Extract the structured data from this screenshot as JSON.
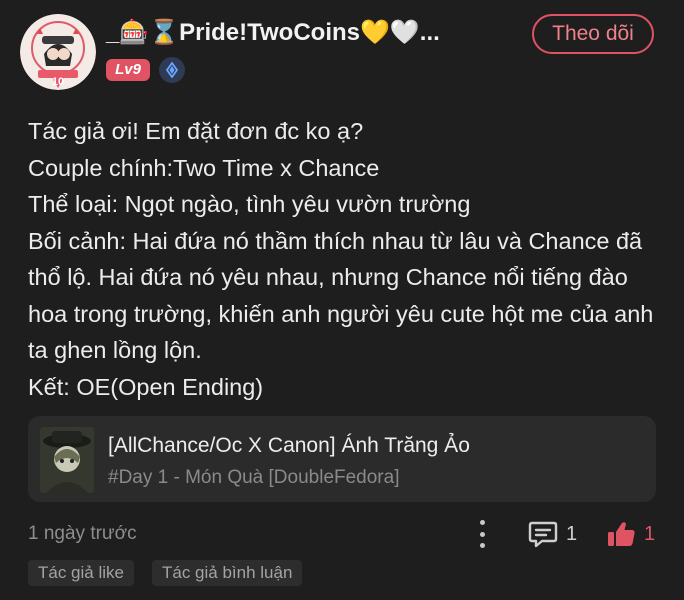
{
  "post": {
    "author": {
      "name": "_🎰⌛Pride!TwoCoins💛🤍...",
      "level": "Lv9",
      "avatar_badge": "10"
    },
    "follow_label": "Theo dõi",
    "body_lines": [
      "Tác giả ơi! Em đặt đơn đc ko ạ?",
      "Couple chính:Two Time x Chance",
      "Thể loại: Ngọt ngào, tình yêu vườn trường",
      "Bối cảnh: Hai đứa nó thầm thích nhau từ lâu và Chance đã thổ lộ. Hai đứa nó yêu nhau, nhưng Chance nổi tiếng đào hoa trong trường, khiến anh người yêu cute hột me của anh ta ghen lồng lộn.",
      "Kết: OE(Open Ending)"
    ],
    "story": {
      "title": "[AllChance/Oc X Canon] Ánh Trăng Ảo",
      "chapter": "#Day 1 - Món Quà [DoubleFedora]"
    },
    "time_ago": "1 ngày trước",
    "comment_count": "1",
    "like_count": "1",
    "tags": [
      "Tác giả like",
      "Tác giả bình luận"
    ]
  },
  "colors": {
    "background": "#1e1e1e",
    "accent": "#e05363",
    "card": "#2b2b2b",
    "muted_text": "#8e8e8e"
  }
}
